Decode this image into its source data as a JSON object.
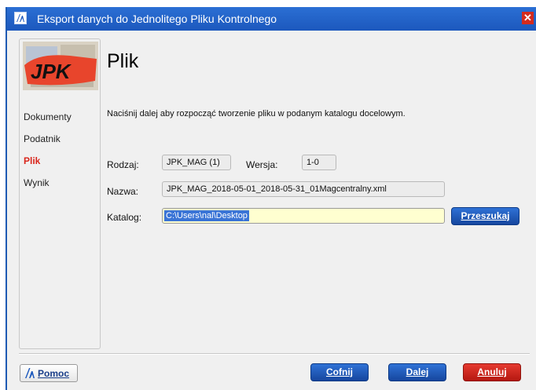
{
  "window": {
    "title": "Eksport danych do Jednolitego Pliku Kontrolnego",
    "close_glyph": "✕",
    "app_icon": "in-logo-icon"
  },
  "sidebar": {
    "logo_text": "JPK",
    "items": [
      {
        "label": "Dokumenty",
        "active": false
      },
      {
        "label": "Podatnik",
        "active": false
      },
      {
        "label": "Plik",
        "active": true
      },
      {
        "label": "Wynik",
        "active": false
      }
    ]
  },
  "main": {
    "title": "Plik",
    "instruction": "Naciśnij dalej aby rozpocząć tworzenie pliku w podanym katalogu docelowym.",
    "form": {
      "rodzaj_label": "Rodzaj:",
      "rodzaj_value": "JPK_MAG (1)",
      "wersja_label": "Wersja:",
      "wersja_value": "1-0",
      "nazwa_label": "Nazwa:",
      "nazwa_value": "JPK_MAG_2018-05-01_2018-05-31_01Magcentralny.xml",
      "katalog_label": "Katalog:",
      "katalog_value": "C:\\Users\\nal\\Desktop",
      "browse_button": "Przeszukaj"
    }
  },
  "footer": {
    "help_button": "Pomoc",
    "back_button": "Cofnij",
    "next_button": "Dalej",
    "cancel_button": "Anuluj"
  },
  "colors": {
    "titlebar": "#1f5fc6",
    "active_nav": "#d9261c",
    "primary_button": "#1d55b5",
    "cancel_button": "#d0261c",
    "catalog_field": "#ffffd0",
    "selection": "#3a74d6"
  }
}
